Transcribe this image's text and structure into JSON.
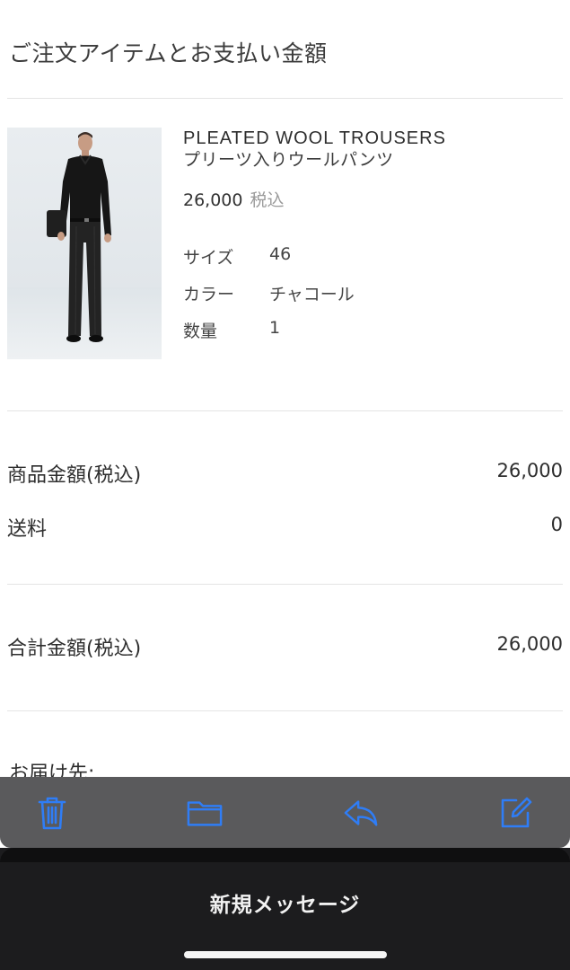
{
  "header": {
    "title": "ご注文アイテムとお支払い金額"
  },
  "item": {
    "name_en": "PLEATED WOOL TROUSERS",
    "name_ja": "プリーツ入りウールパンツ",
    "price": "26,000",
    "price_tax": "税込",
    "specs": [
      {
        "label": "サイズ",
        "value": "46"
      },
      {
        "label": "カラー",
        "value": "チャコール"
      },
      {
        "label": "数量",
        "value": "1"
      }
    ]
  },
  "summary": {
    "subtotal_label": "商品金額(税込)",
    "subtotal_value": "26,000",
    "shipping_label": "送料",
    "shipping_value": "0",
    "total_label": "合計金額(税込)",
    "total_value": "26,000"
  },
  "delivery": {
    "label": "お届け先:"
  },
  "toolbar": {
    "icons": [
      "trash-icon",
      "folder-icon",
      "reply-icon",
      "compose-icon"
    ],
    "icon_color": "#2f7df6"
  },
  "sheet": {
    "title": "新規メッセージ"
  }
}
